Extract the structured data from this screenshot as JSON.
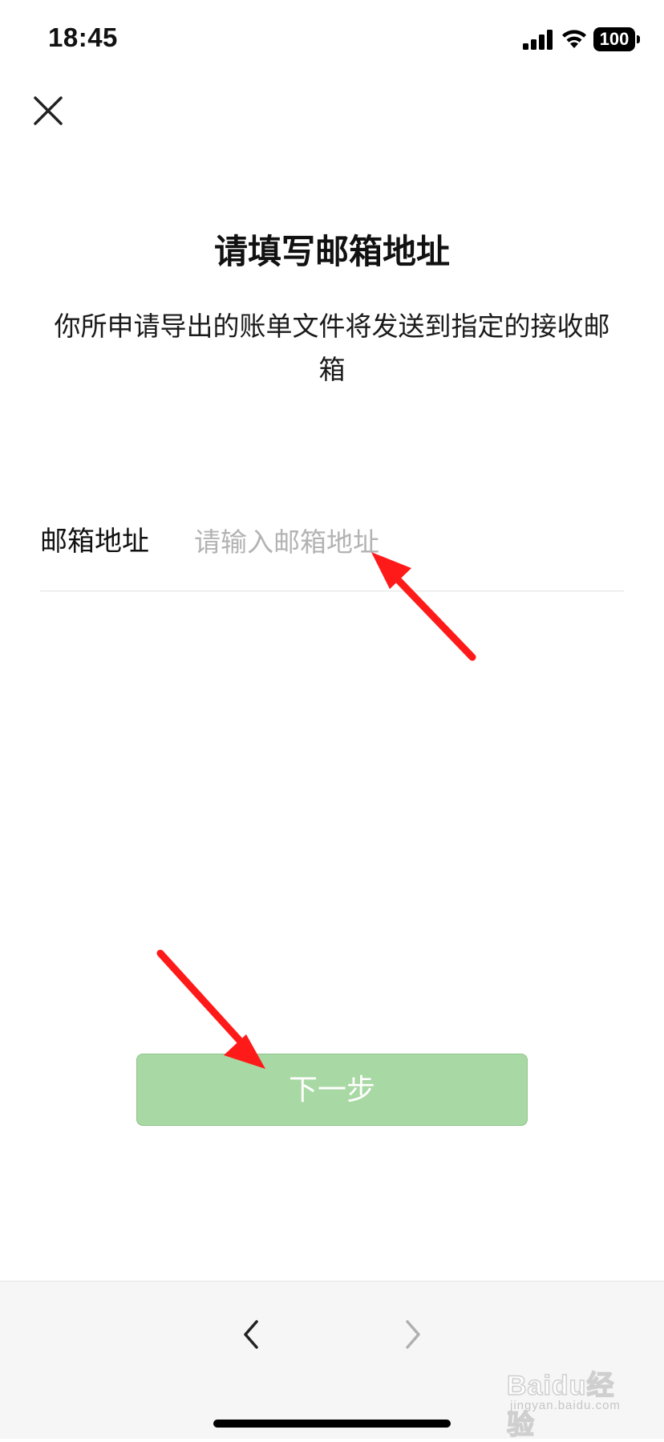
{
  "status_bar": {
    "time": "18:45",
    "battery": "100",
    "icons": [
      "signal-icon",
      "wifi-icon",
      "battery-icon"
    ]
  },
  "header": {
    "close_icon": "close-icon"
  },
  "main": {
    "title": "请填写邮箱地址",
    "description": "你所申请导出的账单文件将发送到指定的接收邮箱"
  },
  "form": {
    "email_label": "邮箱地址",
    "email_placeholder": "请输入邮箱地址",
    "email_value": ""
  },
  "actions": {
    "next_label": "下一步",
    "next_color": "#a8d8a3"
  },
  "annotations": {
    "arrow_color": "#ff1a1a"
  },
  "bottom_toolbar": {
    "back_icon": "chevron-left-icon",
    "forward_icon": "chevron-right-icon"
  },
  "watermark": {
    "brand": "Baidu经验",
    "sub": "jingyan.baidu.com"
  }
}
